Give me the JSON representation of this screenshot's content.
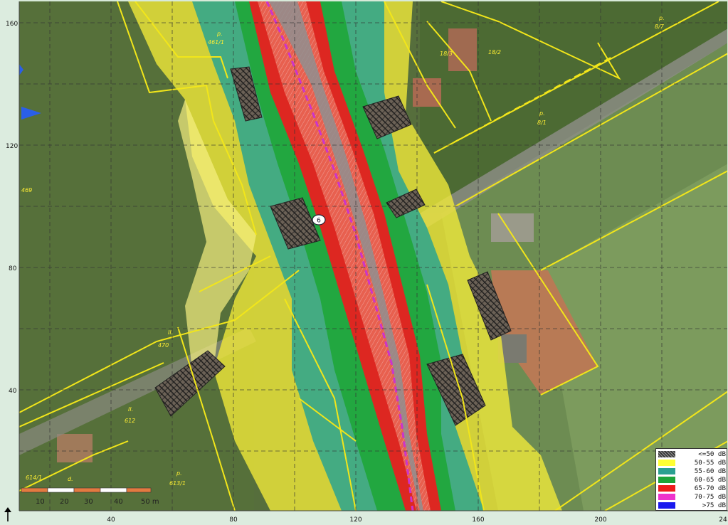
{
  "map": {
    "y_axis_ticks": [
      "160",
      "120",
      "80",
      "40"
    ],
    "x_axis_ticks": [
      "40",
      "80",
      "120",
      "160",
      "200",
      "24"
    ],
    "parcel_labels": [
      "p.",
      "461/1",
      "18/3",
      "18/2",
      "8/7",
      "p.",
      "8/1",
      "p.",
      "469",
      "II.",
      "470",
      "II.",
      "612",
      "p.",
      "613/1",
      "614/1",
      "d."
    ],
    "road_marker": "6",
    "scale_bar": {
      "ticks": [
        "10",
        "20",
        "30",
        "40",
        "50 m"
      ]
    },
    "colors": {
      "le50": "#4a4a4a",
      "d50_55": "#ffff33",
      "d55_60": "#2aa08e",
      "d60_65": "#19a33a",
      "d65_70": "#ee1c1c",
      "d70_75": "#ee33cc",
      "gt75": "#1a1aee",
      "parcel_lines": "#f2e61a",
      "axis_line": "#d13bd1"
    }
  },
  "legend": {
    "items": [
      {
        "label": "<=50 dB",
        "color": "#555555",
        "pattern": "hatch"
      },
      {
        "label": "50-55 dB",
        "color": "#ffff33"
      },
      {
        "label": "55-60 dB",
        "color": "#2aa090"
      },
      {
        "label": "60-65 dB",
        "color": "#1da43a"
      },
      {
        "label": "65-70 dB",
        "color": "#ee1c1c"
      },
      {
        "label": "70-75 dB",
        "color": "#ee33cc"
      },
      {
        "label": ">75 dB",
        "color": "#1a1aee"
      }
    ]
  }
}
